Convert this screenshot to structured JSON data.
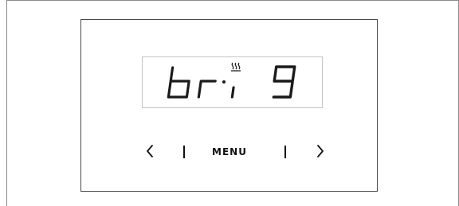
{
  "display": {
    "readout": "bri 9",
    "heat_indicator": "heat-waves-icon"
  },
  "controls": {
    "prev_icon": "chevron-left-icon",
    "menu_label": "MENU",
    "next_icon": "chevron-right-icon"
  }
}
